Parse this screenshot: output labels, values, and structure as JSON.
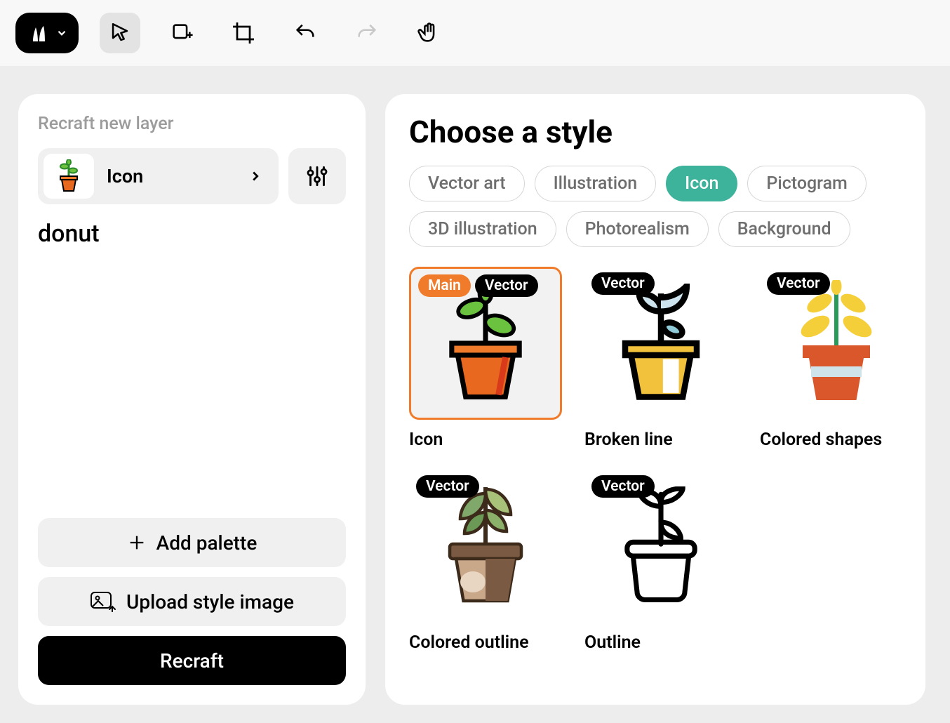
{
  "left": {
    "title": "Recraft new layer",
    "style_label": "Icon",
    "prompt": "donut",
    "add_palette": "Add palette",
    "upload_style": "Upload style image",
    "recraft_btn": "Recraft"
  },
  "right": {
    "title": "Choose a style",
    "categories": [
      "Vector art",
      "Illustration",
      "Icon",
      "Pictogram",
      "3D illustration",
      "Photorealism",
      "Background"
    ],
    "active_category": "Icon"
  },
  "badges": {
    "main": "Main",
    "vector": "Vector"
  },
  "styles": {
    "s1": "Icon",
    "s2": "Broken line",
    "s3": "Colored shapes",
    "s4": "Colored outline",
    "s5": "Outline"
  }
}
